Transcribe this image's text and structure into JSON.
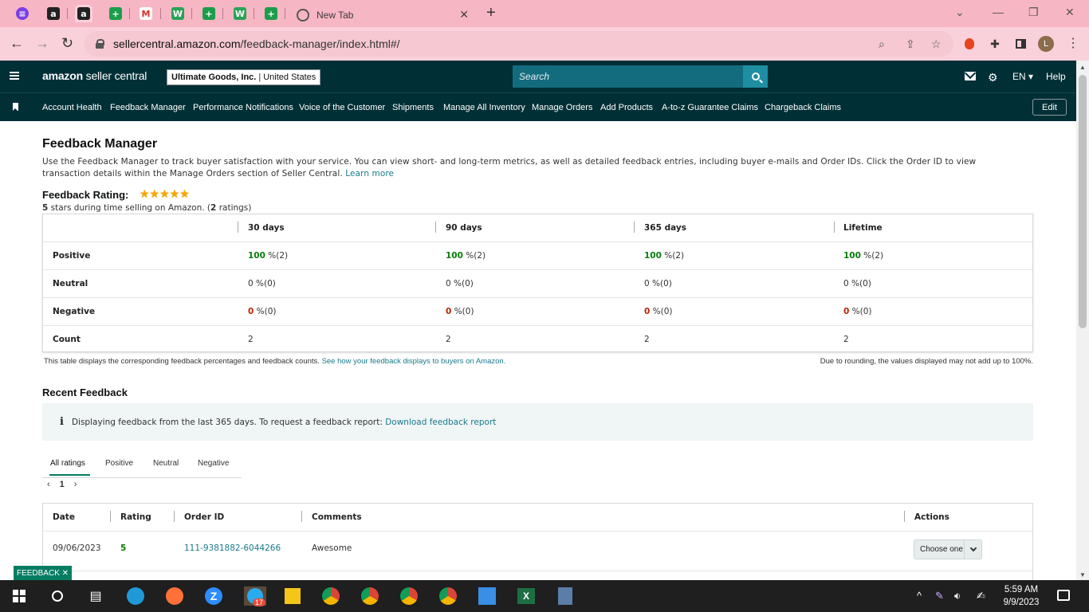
{
  "browser": {
    "tab_title": "New Tab",
    "url_host": "sellercentral.amazon.com",
    "url_path": "/feedback-manager/index.html#/"
  },
  "header": {
    "logo_brand": "amazon",
    "logo_suffix": "seller central",
    "store_name": "Ultimate Goods, Inc.",
    "store_sep": "|",
    "marketplace": "United States",
    "search_placeholder": "Search",
    "language": "EN",
    "help_label": "Help"
  },
  "nav": {
    "items": [
      "Account Health",
      "Feedback Manager",
      "Performance Notifications",
      "Voice of the Customer",
      "Shipments",
      "Manage All Inventory",
      "Manage Orders",
      "Add Products",
      "A-to-z Guarantee Claims",
      "Chargeback Claims"
    ],
    "edit_label": "Edit"
  },
  "page": {
    "title": "Feedback Manager",
    "intro": "Use the Feedback Manager to track buyer satisfaction with your service. You can view short- and long-term metrics, as well as detailed feedback entries, including buyer e-mails and Order IDs. Click the Order ID to view transaction details within the Manage Orders section of Seller Central.",
    "learn_more": "Learn more",
    "rating_title": "Feedback Rating:",
    "stars": "★★★★★",
    "rating_stars_value": 5,
    "rating_sub_bold": "5",
    "rating_sub_mid": " stars during time selling on Amazon. (",
    "rating_sub_count": "2",
    "rating_sub_end": " ratings)"
  },
  "feedback_table": {
    "columns": [
      "30 days",
      "90 days",
      "365 days",
      "Lifetime"
    ],
    "rows": [
      {
        "label": "Positive",
        "cells": [
          [
            "100",
            " %(2)"
          ],
          [
            "100",
            " %(2)"
          ],
          [
            "100",
            " %(2)"
          ],
          [
            "100",
            " %(2)"
          ]
        ]
      },
      {
        "label": "Neutral",
        "cells": [
          [
            "0",
            " %(0)"
          ],
          [
            "0",
            " %(0)"
          ],
          [
            "0",
            " %(0)"
          ],
          [
            "0",
            " %(0)"
          ]
        ]
      },
      {
        "label": "Negative",
        "cells": [
          [
            "0",
            " %(0)"
          ],
          [
            "0",
            " %(0)"
          ],
          [
            "0",
            " %(0)"
          ],
          [
            "0",
            " %(0)"
          ]
        ]
      },
      {
        "label": "Count",
        "cells": [
          [
            "2",
            ""
          ],
          [
            "2",
            ""
          ],
          [
            "2",
            ""
          ],
          [
            "2",
            ""
          ]
        ]
      }
    ],
    "note_left": "This table displays the corresponding feedback percentages and feedback counts.",
    "note_link": "See how your feedback displays to buyers on Amazon.",
    "note_right": "Due to rounding, the values displayed may not add up to 100%."
  },
  "recent": {
    "title": "Recent Feedback",
    "info_icon": "i",
    "info_text": "Displaying feedback from the last 365 days. To request a feedback report:",
    "info_link": "Download feedback report",
    "tabs": [
      "All ratings",
      "Positive",
      "Neutral",
      "Negative"
    ],
    "pager_prev": "‹",
    "pager_page": "1",
    "pager_next": "›",
    "columns": [
      "Date",
      "Rating",
      "Order ID",
      "Comments",
      "Actions"
    ],
    "rows": [
      {
        "date": "09/06/2023",
        "rating": "5",
        "order_id": "111-9381882-6044266",
        "comment": "Awesome",
        "action": "Choose one"
      }
    ]
  },
  "feedback_button": "FEEDBACK ✕",
  "taskbar": {
    "time": "5:59 AM",
    "date": "9/9/2023",
    "badge": "17"
  },
  "colors": {
    "header_bg": "#002f36",
    "search_bg": "#136c7e",
    "positive": "#067d06",
    "negative": "#b12704",
    "link": "#1a7a8c",
    "tabbar": "#f7b6c4"
  }
}
